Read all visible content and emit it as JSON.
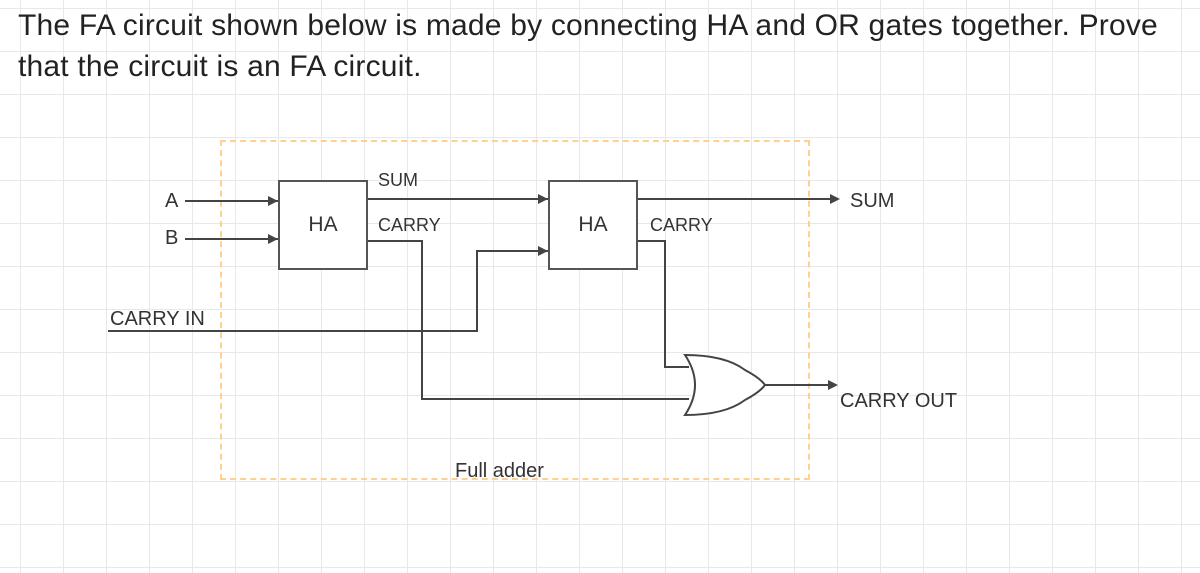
{
  "question": "The FA circuit shown below is made by connecting HA and OR gates together. Prove that the circuit is an FA circuit.",
  "inputs": {
    "a": "A",
    "b": "B",
    "cin": "CARRY IN"
  },
  "ha1": {
    "label": "HA",
    "sum": "SUM",
    "carry": "CARRY"
  },
  "ha2": {
    "label": "HA",
    "carry": "CARRY"
  },
  "outputs": {
    "sum": "SUM",
    "cout": "CARRY OUT"
  },
  "caption": "Full adder"
}
